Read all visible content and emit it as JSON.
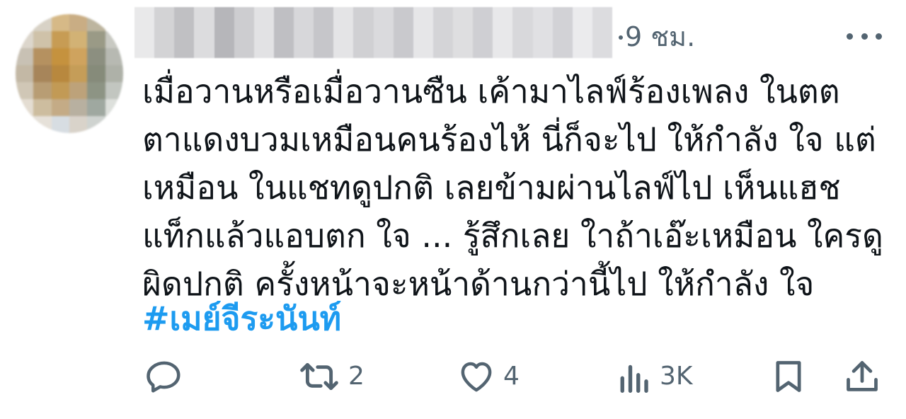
{
  "tweet": {
    "time": "9 ชม.",
    "body_lines": [
      "เมื่อวานหรือเมื่อวานซืน เค้ามาไลฟ์ร้องเพลง ในตต",
      "ตาแดงบวมเหมือนคนร้องไห้ นี่ก็จะไป ให้กำลัง ใจ แต่",
      "เหมือน ในแชทดูปกติ เลยข้ามผ่านไลฟ์ไป เห็นแฮช",
      "แท็กแล้วแอบตก ใจ ... รู้สึกเลย ใาถ้าเอ๊ะเหมือน ใครดู",
      "ผิดปกติ ครั้งหน้าจะหน้าด้านกว่านี้ไป ให้กำลัง ใจ"
    ],
    "hashtag": "#เมย์จีระนันท์"
  },
  "actions": {
    "reply_count": "",
    "retweet_count": "2",
    "like_count": "4",
    "views_count": "3K"
  },
  "icons": {
    "reply": "reply-icon",
    "retweet": "retweet-icon",
    "like": "heart-icon",
    "views": "views-icon",
    "bookmark": "bookmark-icon",
    "share": "share-icon",
    "more": "more-icon"
  },
  "colors": {
    "text": "#0f1419",
    "muted": "#536471",
    "link": "#1d9bf0"
  }
}
